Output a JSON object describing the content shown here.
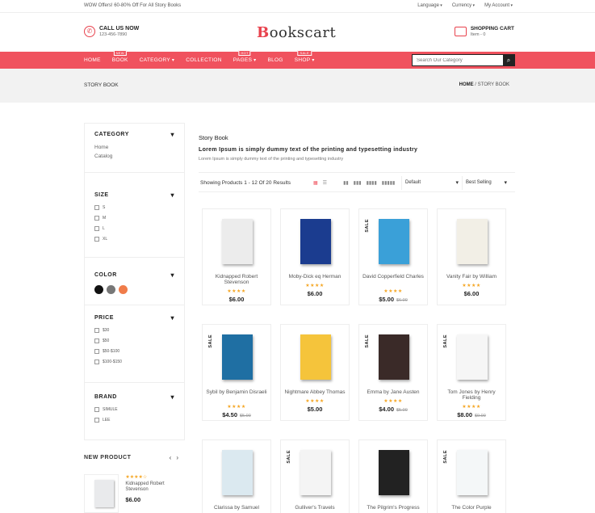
{
  "topbar": {
    "offer": "WOW Offers! 60-80% Off For All Story Books",
    "language": "Language",
    "currency": "Currency",
    "account": "My Account"
  },
  "header": {
    "call_title": "CALL US NOW",
    "call_number": "123-456-7890",
    "logo_first": "B",
    "logo_rest": "ookscart",
    "cart_title": "SHOPPING CART",
    "cart_count": "Item - 0"
  },
  "nav": {
    "items": [
      "HOME",
      "BOOK",
      "CATEGORY",
      "COLLECTION",
      "PAGES",
      "BLOG",
      "SHOP"
    ],
    "badges": {
      "book": "NEW",
      "pages": "HOT",
      "shop": "SALE"
    },
    "search_placeholder": "Search Our Category"
  },
  "breadcrumb": {
    "page_title": "STORY BOOK",
    "home": "HOME",
    "separator": "/",
    "current": "STORY BOOK"
  },
  "sidebar": {
    "category": {
      "title": "CATEGORY",
      "links": [
        "Home",
        "Catalog"
      ]
    },
    "size": {
      "title": "SIZE",
      "options": [
        "S",
        "M",
        "L",
        "XL"
      ]
    },
    "color": {
      "title": "COLOR",
      "swatches": [
        "#111111",
        "#777777",
        "#f07c4a"
      ]
    },
    "price": {
      "title": "PRICE",
      "options": [
        "$30",
        "$50",
        "$50-$100",
        "$100-$150"
      ]
    },
    "brand": {
      "title": "BRAND",
      "options": [
        "SIMULE",
        "LEE"
      ]
    }
  },
  "new_product": {
    "title": "NEW PRODUCT",
    "prev": "‹",
    "next": "›",
    "item": {
      "stars": "★★★★☆",
      "name": "Kidnapped Robert Stevenson",
      "price": "$6.00"
    }
  },
  "main": {
    "title": "Story Book",
    "subtitle": "Lorem Ipsum is simply dummy text of the printing and typesetting industry",
    "description": "Lorem Ipsum is simply dummy text of the printing and typesetting industry",
    "results": "Showing Products 1 - 12 Of 20 Results",
    "sort_default": "Default",
    "sort_order": "Best Selling"
  },
  "products": [
    {
      "name": "Kidnapped Robert Stevenson",
      "stars": "★★★★",
      "price": "$6.00",
      "old": "",
      "sale": false,
      "cover": "#ececec"
    },
    {
      "name": "Moby-Dick eq Herman",
      "stars": "★★★★",
      "price": "$6.00",
      "old": "",
      "sale": false,
      "cover": "#1b3c8f"
    },
    {
      "name": "David Copperfield Charles",
      "stars": "★★★★",
      "price": "$5.00",
      "old": "$6.00",
      "sale": true,
      "cover": "#3aa0d8"
    },
    {
      "name": "Vanity Fair by William",
      "stars": "★★★★",
      "price": "$6.00",
      "old": "",
      "sale": false,
      "cover": "#f2efe6"
    },
    {
      "name": "Sybil by Benjamin Disraeli",
      "stars": "★★★★",
      "price": "$4.50",
      "old": "$5.00",
      "sale": true,
      "cover": "#1f6fa3"
    },
    {
      "name": "Nightmare Abbey Thomas",
      "stars": "★★★★",
      "price": "$5.00",
      "old": "",
      "sale": false,
      "cover": "#f5c43b"
    },
    {
      "name": "Emma by Jane Austen",
      "stars": "★★★★",
      "price": "$4.00",
      "old": "$5.00",
      "sale": true,
      "cover": "#3a2a28"
    },
    {
      "name": "Tom Jones by Henry Fielding",
      "stars": "★★★★",
      "price": "$8.00",
      "old": "$9.00",
      "sale": true,
      "cover": "#f6f6f6"
    },
    {
      "name": "Clarissa by Samuel",
      "stars": "",
      "price": "",
      "old": "",
      "sale": false,
      "cover": "#dbe9f0"
    },
    {
      "name": "Gulliver's Travels",
      "stars": "",
      "price": "",
      "old": "",
      "sale": true,
      "cover": "#f4f4f4"
    },
    {
      "name": "The Pilgrim's Progress",
      "stars": "",
      "price": "",
      "old": "",
      "sale": false,
      "cover": "#222222"
    },
    {
      "name": "The Color Purple",
      "stars": "",
      "price": "",
      "old": "",
      "sale": true,
      "cover": "#f4f7f8"
    }
  ]
}
